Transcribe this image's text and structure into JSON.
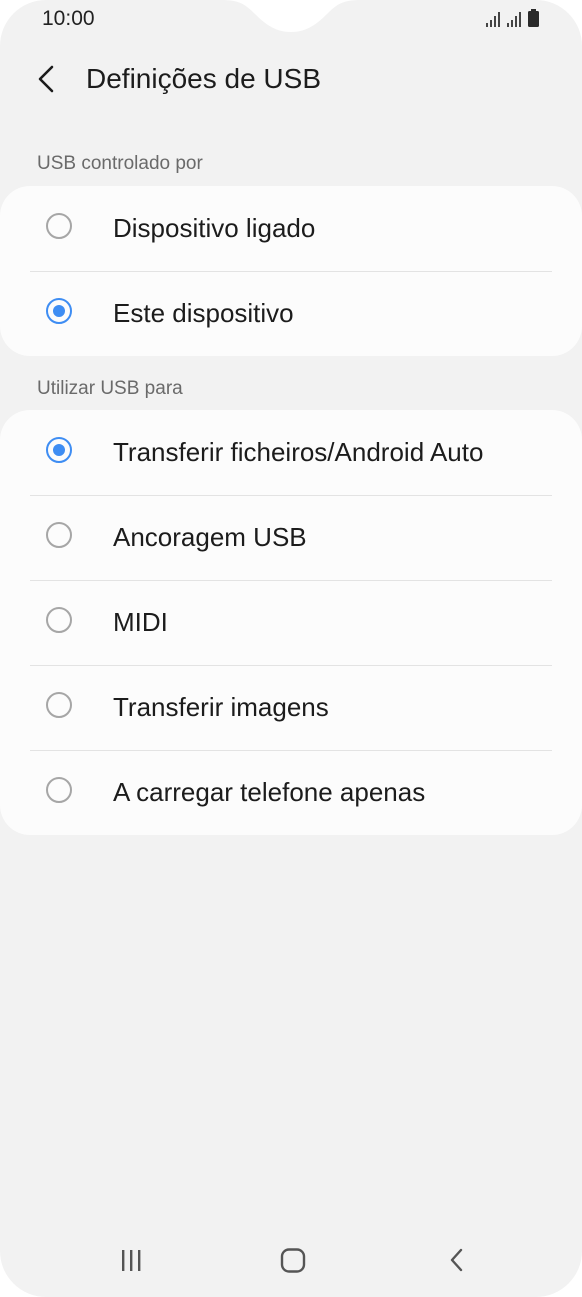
{
  "status_bar": {
    "time": "10:00",
    "icons": [
      "signal-icon",
      "signal-icon",
      "battery-icon"
    ]
  },
  "app_bar": {
    "back_icon": "chevron-left-icon",
    "title": "Definições de USB"
  },
  "usb_controlled_by": {
    "header": "USB controlado por",
    "options": [
      {
        "label": "Dispositivo ligado",
        "selected": false
      },
      {
        "label": "Este dispositivo",
        "selected": true
      }
    ]
  },
  "use_usb_for": {
    "header": "Utilizar USB para",
    "options": [
      {
        "label": "Transferir ficheiros/Android Auto",
        "selected": true
      },
      {
        "label": "Ancoragem USB",
        "selected": false
      },
      {
        "label": "MIDI",
        "selected": false
      },
      {
        "label": "Transferir imagens",
        "selected": false
      },
      {
        "label": "A carregar telefone apenas",
        "selected": false
      }
    ]
  },
  "nav_bar": {
    "buttons": [
      "recents-icon",
      "home-icon",
      "back-icon"
    ]
  },
  "colors": {
    "accent": "#3e8df3",
    "background": "#f2f2f2",
    "card": "#fcfcfc"
  }
}
